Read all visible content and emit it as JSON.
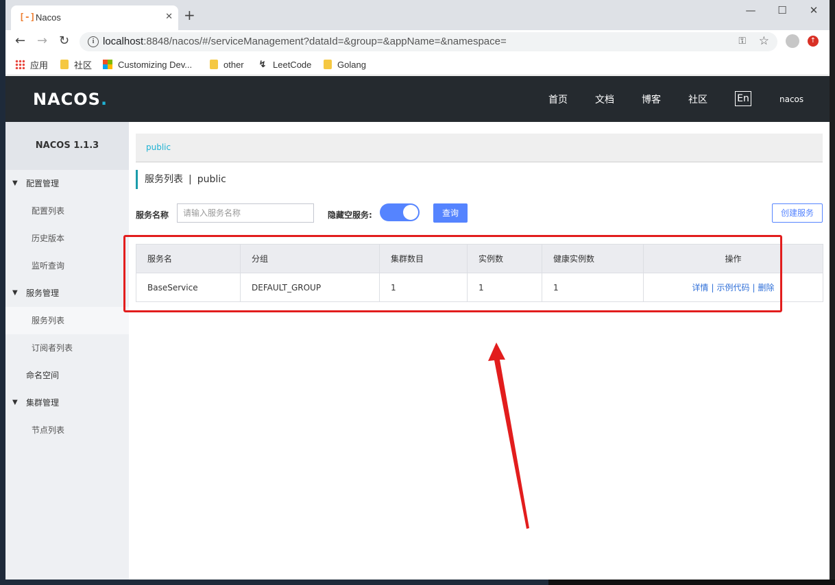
{
  "browser": {
    "tab_title": "Nacos",
    "tab_favicon": "[-]",
    "url_host": "localhost",
    "url_rest": ":8848/nacos/#/serviceManagement?dataId=&group=&appName=&namespace=",
    "bookmarks": [
      {
        "label": "应用",
        "icon": "apps-grid-icon"
      },
      {
        "label": "社区",
        "icon": "folder-icon"
      },
      {
        "label": "Customizing Dev...",
        "icon": "microsoft-icon"
      },
      {
        "label": "other",
        "icon": "folder-icon"
      },
      {
        "label": "LeetCode",
        "icon": "leetcode-icon"
      },
      {
        "label": "Golang",
        "icon": "folder-icon"
      }
    ]
  },
  "header": {
    "logo": "NACOS",
    "logo_dot": ".",
    "nav": [
      "首页",
      "文档",
      "博客",
      "社区"
    ],
    "lang": "En",
    "user": "nacos"
  },
  "sidebar": {
    "version": "NACOS 1.1.3",
    "items": [
      {
        "label": "配置管理",
        "type": "group"
      },
      {
        "label": "配置列表",
        "type": "sub"
      },
      {
        "label": "历史版本",
        "type": "sub"
      },
      {
        "label": "监听查询",
        "type": "sub"
      },
      {
        "label": "服务管理",
        "type": "group"
      },
      {
        "label": "服务列表",
        "type": "sub",
        "active": true
      },
      {
        "label": "订阅者列表",
        "type": "sub"
      },
      {
        "label": "命名空间",
        "type": "plain"
      },
      {
        "label": "集群管理",
        "type": "group"
      },
      {
        "label": "节点列表",
        "type": "sub"
      }
    ]
  },
  "main": {
    "namespace_link": "public",
    "title": "服务列表",
    "title_sep": "|",
    "title_ns": "public",
    "search": {
      "name_label": "服务名称",
      "name_placeholder": "请输入服务名称",
      "hide_empty_label": "隐藏空服务:",
      "hide_empty_on": true,
      "query_button": "查询",
      "create_button": "创建服务"
    },
    "table": {
      "headers": [
        "服务名",
        "分组",
        "集群数目",
        "实例数",
        "健康实例数",
        "操作"
      ],
      "rows": [
        {
          "name": "BaseService",
          "group": "DEFAULT_GROUP",
          "clusters": "1",
          "instances": "1",
          "healthy": "1"
        }
      ],
      "ops": [
        "详情",
        "示例代码",
        "删除"
      ],
      "op_sep": "|"
    }
  },
  "colors": {
    "header_bg": "#252a2f",
    "primary": "#5584ff",
    "accent": "#1fb2d4",
    "annotation": "#e21d1d"
  }
}
